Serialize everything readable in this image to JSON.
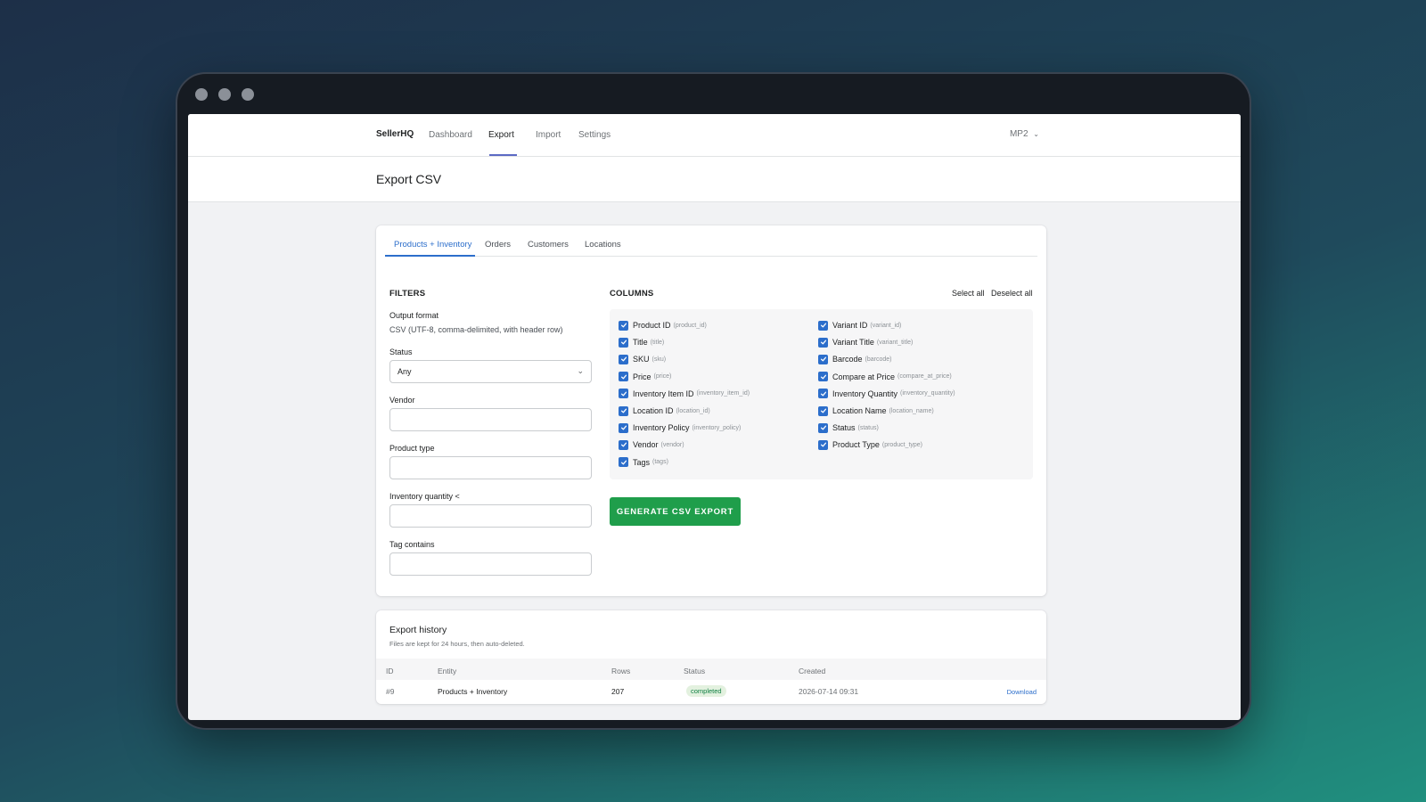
{
  "nav": {
    "brand": "SellerHQ",
    "links": [
      "Dashboard",
      "Export",
      "Import",
      "Settings"
    ],
    "active": "Export",
    "store": "MP2"
  },
  "page": {
    "title": "Export CSV"
  },
  "tabs": [
    "Products + Inventory",
    "Orders",
    "Customers",
    "Locations"
  ],
  "filters": {
    "title": "FILTERS",
    "output_format_label": "Output format",
    "output_format_value": "CSV (UTF-8, comma-delimited, with header row)",
    "status_label": "Status",
    "status_value": "Any",
    "vendor_label": "Vendor",
    "product_type_label": "Product type",
    "inventory_label": "Inventory quantity <",
    "tag_label": "Tag contains"
  },
  "columns": {
    "title": "COLUMNS",
    "select_all": "Select all",
    "deselect_all": "Deselect all",
    "left": [
      {
        "label": "Product ID",
        "key": "(product_id)"
      },
      {
        "label": "Title",
        "key": "(title)"
      },
      {
        "label": "SKU",
        "key": "(sku)"
      },
      {
        "label": "Price",
        "key": "(price)"
      },
      {
        "label": "Inventory Item ID",
        "key": "(inventory_item_id)"
      },
      {
        "label": "Location ID",
        "key": "(location_id)"
      },
      {
        "label": "Inventory Policy",
        "key": "(inventory_policy)"
      },
      {
        "label": "Vendor",
        "key": "(vendor)"
      },
      {
        "label": "Tags",
        "key": "(tags)"
      }
    ],
    "right": [
      {
        "label": "Variant ID",
        "key": "(variant_id)"
      },
      {
        "label": "Variant Title",
        "key": "(variant_title)"
      },
      {
        "label": "Barcode",
        "key": "(barcode)"
      },
      {
        "label": "Compare at Price",
        "key": "(compare_at_price)"
      },
      {
        "label": "Inventory Quantity",
        "key": "(inventory_quantity)"
      },
      {
        "label": "Location Name",
        "key": "(location_name)"
      },
      {
        "label": "Status",
        "key": "(status)"
      },
      {
        "label": "Product Type",
        "key": "(product_type)"
      }
    ]
  },
  "generate_button": "GENERATE CSV EXPORT",
  "history": {
    "title": "Export history",
    "subtitle": "Files are kept for 24 hours, then auto-deleted.",
    "headers": [
      "ID",
      "Entity",
      "Rows",
      "Status",
      "Created"
    ],
    "rows": [
      {
        "id": "#9",
        "entity": "Products + Inventory",
        "rows": "207",
        "status": "completed",
        "created": "2026-07-14 09:31",
        "action": "Download"
      }
    ]
  },
  "colors": {
    "accent": "#2c6ecb",
    "primary_button": "#1f9e4b",
    "nav_active": "#5c6ac4"
  }
}
